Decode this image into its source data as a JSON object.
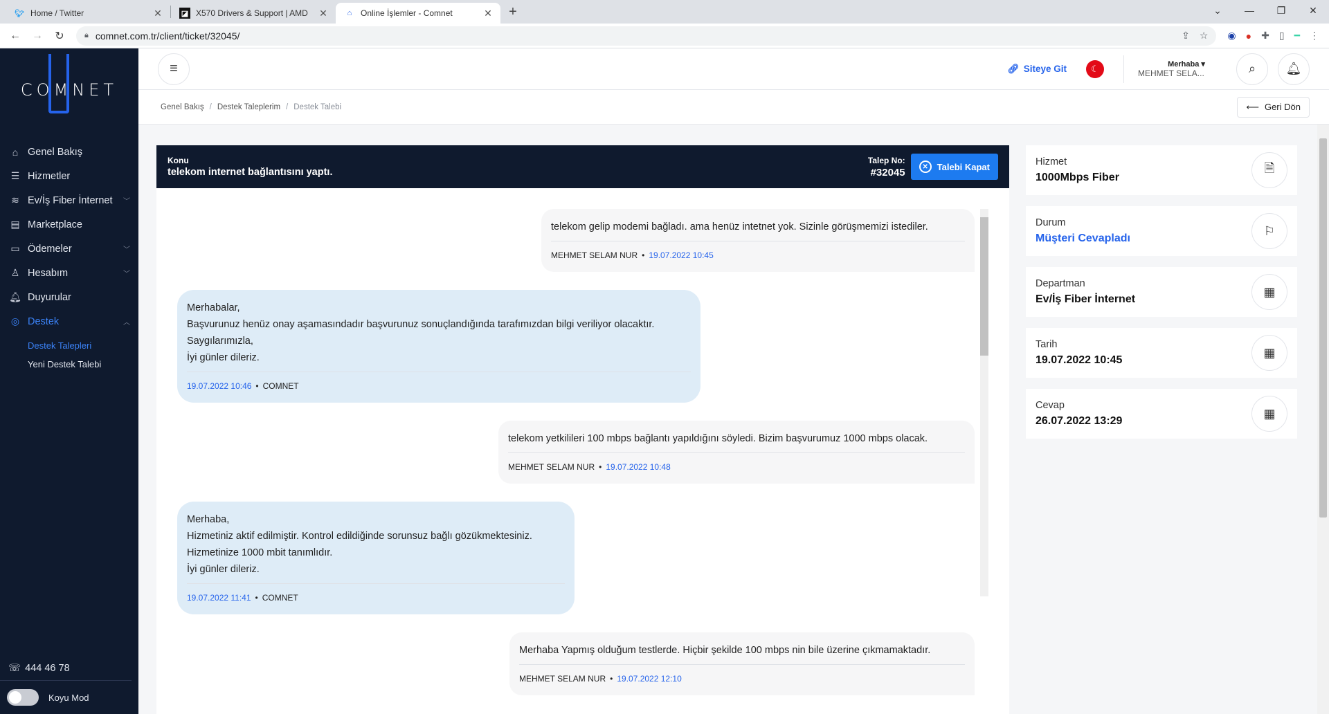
{
  "browser": {
    "tabs": [
      {
        "title": "Home / Twitter",
        "icon": "twitter-icon"
      },
      {
        "title": "X570 Drivers & Support | AMD",
        "icon": "amd-icon"
      },
      {
        "title": "Online İşlemler - Comnet",
        "icon": "comnet-icon",
        "active": true
      }
    ],
    "url": "comnet.com.tr/client/ticket/32045/"
  },
  "sidebar": {
    "logo": "COMNET",
    "items": [
      {
        "label": "Genel Bakış",
        "icon": "home-icon"
      },
      {
        "label": "Hizmetler",
        "icon": "list-icon"
      },
      {
        "label": "Ev/İş Fiber İnternet",
        "icon": "wifi-icon",
        "chevron": true
      },
      {
        "label": "Marketplace",
        "icon": "store-icon"
      },
      {
        "label": "Ödemeler",
        "icon": "wallet-icon",
        "chevron": true
      },
      {
        "label": "Hesabım",
        "icon": "user-icon",
        "chevron": true
      },
      {
        "label": "Duyurular",
        "icon": "bell-icon"
      },
      {
        "label": "Destek",
        "icon": "support-icon",
        "chevron": true,
        "active": true
      }
    ],
    "submenu": [
      {
        "label": "Destek Talepleri",
        "active": true
      },
      {
        "label": "Yeni Destek Talebi"
      }
    ],
    "phone": "444 46 78",
    "dark_mode": "Koyu Mod"
  },
  "topbar": {
    "site_link": "Siteye Git",
    "greeting": "Merhaba",
    "user_name": "MEHMET SELA..."
  },
  "breadcrumb": [
    "Genel Bakış",
    "Destek Taleplerim",
    "Destek Talebi"
  ],
  "back_button": "Geri Dön",
  "ticket": {
    "subject_label": "Konu",
    "subject": "telekom internet bağlantısını yaptı.",
    "no_label": "Talep No:",
    "no": "#32045",
    "close_label": "Talebi Kapat",
    "messages": [
      {
        "type": "user",
        "lines": [
          "telekom gelip modemi bağladı. ama henüz intetnet yok.  Sizinle görüşmemizi istediler."
        ],
        "author": "MEHMET SELAM NUR",
        "date": "19.07.2022 10:45"
      },
      {
        "type": "staff",
        "lines": [
          "Merhabalar,",
          "Başvurunuz henüz onay aşamasındadır başvurunuz sonuçlandığında tarafımızdan bilgi veriliyor olacaktır.",
          "Saygılarımızla,",
          "İyi günler dileriz."
        ],
        "author": "COMNET",
        "date": "19.07.2022 10:46"
      },
      {
        "type": "user",
        "lines": [
          "telekom yetkilileri 100 mbps bağlantı yapıldığını söyledi. Bizim başvurumuz 1000 mbps olacak."
        ],
        "author": "MEHMET SELAM NUR",
        "date": "19.07.2022 10:48"
      },
      {
        "type": "staff",
        "lines": [
          "Merhaba,",
          "Hizmetiniz aktif edilmiştir. Kontrol edildiğinde sorunsuz bağlı gözükmektesiniz.",
          "Hizmetinize 1000 mbit tanımlıdır.",
          "İyi günler dileriz."
        ],
        "author": "COMNET",
        "date": "19.07.2022 11:41"
      },
      {
        "type": "user",
        "lines": [
          "Merhaba Yapmış olduğum testlerde. Hiçbir şekilde 100 mbps nin bile üzerine çıkmamaktadır."
        ],
        "author": "MEHMET SELAM NUR",
        "date": "19.07.2022 12:10"
      }
    ]
  },
  "info": [
    {
      "label": "Hizmet",
      "value": "1000Mbps Fiber",
      "icon": "document-icon"
    },
    {
      "label": "Durum",
      "value": "Müşteri Cevapladı",
      "icon": "flag-icon",
      "highlight": true
    },
    {
      "label": "Departman",
      "value": "Ev/İş Fiber İnternet",
      "icon": "building-icon"
    },
    {
      "label": "Tarih",
      "value": "19.07.2022 10:45",
      "icon": "calendar-icon"
    },
    {
      "label": "Cevap",
      "value": "26.07.2022 13:29",
      "icon": "calendar-icon"
    }
  ]
}
